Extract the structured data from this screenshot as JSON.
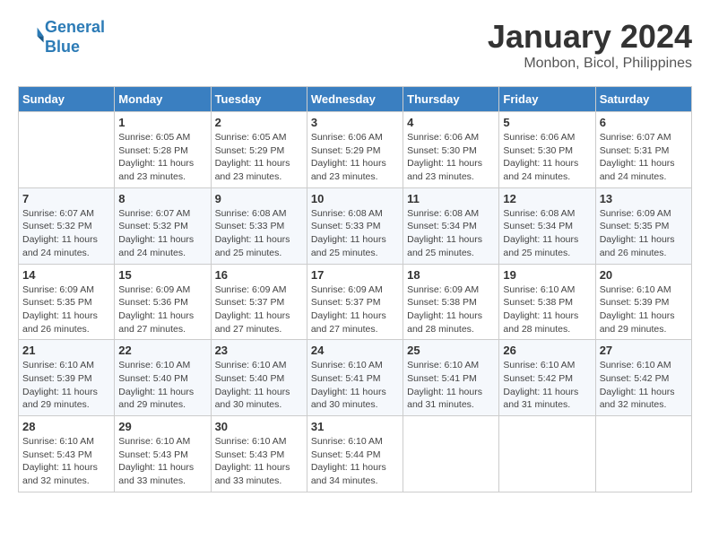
{
  "header": {
    "logo_line1": "General",
    "logo_line2": "Blue",
    "month_year": "January 2024",
    "location": "Monbon, Bicol, Philippines"
  },
  "weekdays": [
    "Sunday",
    "Monday",
    "Tuesday",
    "Wednesday",
    "Thursday",
    "Friday",
    "Saturday"
  ],
  "weeks": [
    [
      {
        "day": "",
        "sunrise": "",
        "sunset": "",
        "daylight": ""
      },
      {
        "day": "1",
        "sunrise": "Sunrise: 6:05 AM",
        "sunset": "Sunset: 5:28 PM",
        "daylight": "Daylight: 11 hours and 23 minutes."
      },
      {
        "day": "2",
        "sunrise": "Sunrise: 6:05 AM",
        "sunset": "Sunset: 5:29 PM",
        "daylight": "Daylight: 11 hours and 23 minutes."
      },
      {
        "day": "3",
        "sunrise": "Sunrise: 6:06 AM",
        "sunset": "Sunset: 5:29 PM",
        "daylight": "Daylight: 11 hours and 23 minutes."
      },
      {
        "day": "4",
        "sunrise": "Sunrise: 6:06 AM",
        "sunset": "Sunset: 5:30 PM",
        "daylight": "Daylight: 11 hours and 23 minutes."
      },
      {
        "day": "5",
        "sunrise": "Sunrise: 6:06 AM",
        "sunset": "Sunset: 5:30 PM",
        "daylight": "Daylight: 11 hours and 24 minutes."
      },
      {
        "day": "6",
        "sunrise": "Sunrise: 6:07 AM",
        "sunset": "Sunset: 5:31 PM",
        "daylight": "Daylight: 11 hours and 24 minutes."
      }
    ],
    [
      {
        "day": "7",
        "sunrise": "Sunrise: 6:07 AM",
        "sunset": "Sunset: 5:32 PM",
        "daylight": "Daylight: 11 hours and 24 minutes."
      },
      {
        "day": "8",
        "sunrise": "Sunrise: 6:07 AM",
        "sunset": "Sunset: 5:32 PM",
        "daylight": "Daylight: 11 hours and 24 minutes."
      },
      {
        "day": "9",
        "sunrise": "Sunrise: 6:08 AM",
        "sunset": "Sunset: 5:33 PM",
        "daylight": "Daylight: 11 hours and 25 minutes."
      },
      {
        "day": "10",
        "sunrise": "Sunrise: 6:08 AM",
        "sunset": "Sunset: 5:33 PM",
        "daylight": "Daylight: 11 hours and 25 minutes."
      },
      {
        "day": "11",
        "sunrise": "Sunrise: 6:08 AM",
        "sunset": "Sunset: 5:34 PM",
        "daylight": "Daylight: 11 hours and 25 minutes."
      },
      {
        "day": "12",
        "sunrise": "Sunrise: 6:08 AM",
        "sunset": "Sunset: 5:34 PM",
        "daylight": "Daylight: 11 hours and 25 minutes."
      },
      {
        "day": "13",
        "sunrise": "Sunrise: 6:09 AM",
        "sunset": "Sunset: 5:35 PM",
        "daylight": "Daylight: 11 hours and 26 minutes."
      }
    ],
    [
      {
        "day": "14",
        "sunrise": "Sunrise: 6:09 AM",
        "sunset": "Sunset: 5:35 PM",
        "daylight": "Daylight: 11 hours and 26 minutes."
      },
      {
        "day": "15",
        "sunrise": "Sunrise: 6:09 AM",
        "sunset": "Sunset: 5:36 PM",
        "daylight": "Daylight: 11 hours and 27 minutes."
      },
      {
        "day": "16",
        "sunrise": "Sunrise: 6:09 AM",
        "sunset": "Sunset: 5:37 PM",
        "daylight": "Daylight: 11 hours and 27 minutes."
      },
      {
        "day": "17",
        "sunrise": "Sunrise: 6:09 AM",
        "sunset": "Sunset: 5:37 PM",
        "daylight": "Daylight: 11 hours and 27 minutes."
      },
      {
        "day": "18",
        "sunrise": "Sunrise: 6:09 AM",
        "sunset": "Sunset: 5:38 PM",
        "daylight": "Daylight: 11 hours and 28 minutes."
      },
      {
        "day": "19",
        "sunrise": "Sunrise: 6:10 AM",
        "sunset": "Sunset: 5:38 PM",
        "daylight": "Daylight: 11 hours and 28 minutes."
      },
      {
        "day": "20",
        "sunrise": "Sunrise: 6:10 AM",
        "sunset": "Sunset: 5:39 PM",
        "daylight": "Daylight: 11 hours and 29 minutes."
      }
    ],
    [
      {
        "day": "21",
        "sunrise": "Sunrise: 6:10 AM",
        "sunset": "Sunset: 5:39 PM",
        "daylight": "Daylight: 11 hours and 29 minutes."
      },
      {
        "day": "22",
        "sunrise": "Sunrise: 6:10 AM",
        "sunset": "Sunset: 5:40 PM",
        "daylight": "Daylight: 11 hours and 29 minutes."
      },
      {
        "day": "23",
        "sunrise": "Sunrise: 6:10 AM",
        "sunset": "Sunset: 5:40 PM",
        "daylight": "Daylight: 11 hours and 30 minutes."
      },
      {
        "day": "24",
        "sunrise": "Sunrise: 6:10 AM",
        "sunset": "Sunset: 5:41 PM",
        "daylight": "Daylight: 11 hours and 30 minutes."
      },
      {
        "day": "25",
        "sunrise": "Sunrise: 6:10 AM",
        "sunset": "Sunset: 5:41 PM",
        "daylight": "Daylight: 11 hours and 31 minutes."
      },
      {
        "day": "26",
        "sunrise": "Sunrise: 6:10 AM",
        "sunset": "Sunset: 5:42 PM",
        "daylight": "Daylight: 11 hours and 31 minutes."
      },
      {
        "day": "27",
        "sunrise": "Sunrise: 6:10 AM",
        "sunset": "Sunset: 5:42 PM",
        "daylight": "Daylight: 11 hours and 32 minutes."
      }
    ],
    [
      {
        "day": "28",
        "sunrise": "Sunrise: 6:10 AM",
        "sunset": "Sunset: 5:43 PM",
        "daylight": "Daylight: 11 hours and 32 minutes."
      },
      {
        "day": "29",
        "sunrise": "Sunrise: 6:10 AM",
        "sunset": "Sunset: 5:43 PM",
        "daylight": "Daylight: 11 hours and 33 minutes."
      },
      {
        "day": "30",
        "sunrise": "Sunrise: 6:10 AM",
        "sunset": "Sunset: 5:43 PM",
        "daylight": "Daylight: 11 hours and 33 minutes."
      },
      {
        "day": "31",
        "sunrise": "Sunrise: 6:10 AM",
        "sunset": "Sunset: 5:44 PM",
        "daylight": "Daylight: 11 hours and 34 minutes."
      },
      {
        "day": "",
        "sunrise": "",
        "sunset": "",
        "daylight": ""
      },
      {
        "day": "",
        "sunrise": "",
        "sunset": "",
        "daylight": ""
      },
      {
        "day": "",
        "sunrise": "",
        "sunset": "",
        "daylight": ""
      }
    ]
  ]
}
